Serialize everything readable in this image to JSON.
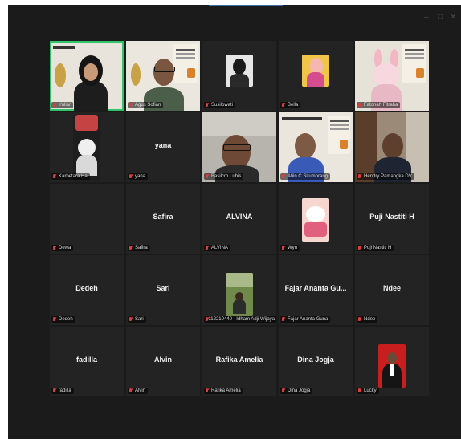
{
  "window": {
    "controls": [
      "–",
      "□",
      "✕"
    ]
  },
  "participants": [
    {
      "label": "Yuliar",
      "big_name": "",
      "type": "video",
      "active": true
    },
    {
      "label": "Agus Sofian",
      "big_name": "",
      "type": "video"
    },
    {
      "label": "Susilowati",
      "big_name": "",
      "type": "avatar"
    },
    {
      "label": "Bella",
      "big_name": "",
      "type": "avatar"
    },
    {
      "label": "Fatonah Fitraha",
      "big_name": "",
      "type": "video"
    },
    {
      "label": "Karbetara Ha",
      "big_name": "",
      "type": "avatar"
    },
    {
      "label": "yana",
      "big_name": "yana",
      "type": "name"
    },
    {
      "label": "Basilcro Lubis",
      "big_name": "",
      "type": "video"
    },
    {
      "label": "Afiin C Situmorang",
      "big_name": "",
      "type": "video"
    },
    {
      "label": "Hendry Pamangka DV",
      "big_name": "",
      "type": "video"
    },
    {
      "label": "Dewa",
      "big_name": "",
      "type": "name"
    },
    {
      "label": "Safira",
      "big_name": "Safira",
      "type": "name"
    },
    {
      "label": "ALVINA",
      "big_name": "ALVINA",
      "type": "name"
    },
    {
      "label": "Wyn",
      "big_name": "",
      "type": "avatar"
    },
    {
      "label": "Puji Nastiti H",
      "big_name": "Puji Nastiti H",
      "type": "name"
    },
    {
      "label": "Dedeh",
      "big_name": "Dedeh",
      "type": "name"
    },
    {
      "label": "Sari",
      "big_name": "Sari",
      "type": "name"
    },
    {
      "label": "112210440 - Idham Adji Wijaya",
      "big_name": "",
      "type": "avatar"
    },
    {
      "label": "Fajar Ananta Guna",
      "big_name": "Fajar Ananta Gu...",
      "type": "name"
    },
    {
      "label": "Ndee",
      "big_name": "Ndee",
      "type": "name"
    },
    {
      "label": "fadilla",
      "big_name": "fadilla",
      "type": "name"
    },
    {
      "label": "Alvin",
      "big_name": "Alvin",
      "type": "name"
    },
    {
      "label": "Rafika Amelia",
      "big_name": "Rafika Amelia",
      "type": "name"
    },
    {
      "label": "Dina Jogja",
      "big_name": "Dina Jogja",
      "type": "name"
    },
    {
      "label": "Lucky",
      "big_name": "",
      "type": "avatar"
    }
  ]
}
